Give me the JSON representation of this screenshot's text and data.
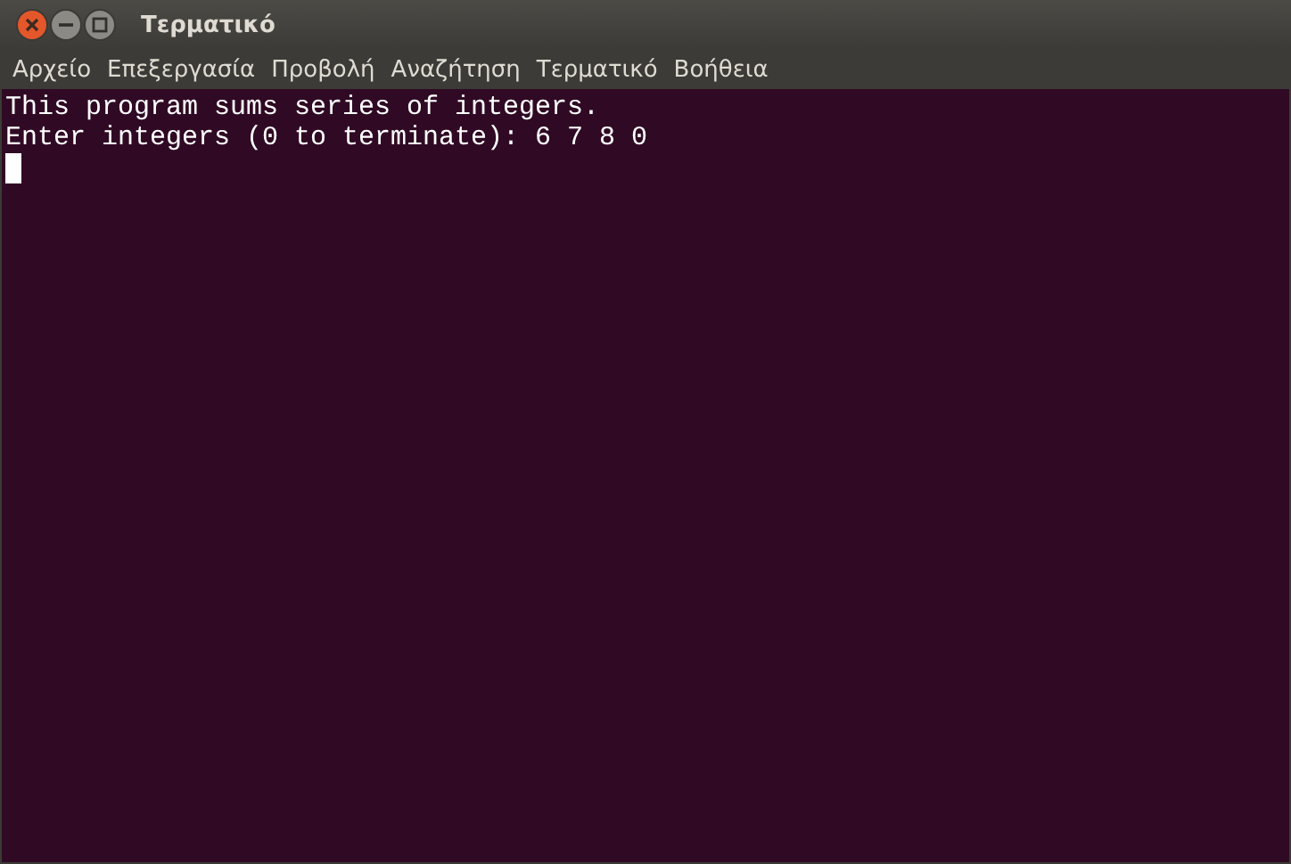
{
  "window": {
    "title": "Τερματικό"
  },
  "menu": [
    "Αρχείο",
    "Επεξεργασία",
    "Προβολή",
    "Αναζήτηση",
    "Τερματικό",
    "Βοήθεια"
  ],
  "terminal": {
    "lines": [
      "This program sums series of integers.",
      "Enter integers (0 to terminate): 6 7 8 0"
    ],
    "cursor": true
  }
}
